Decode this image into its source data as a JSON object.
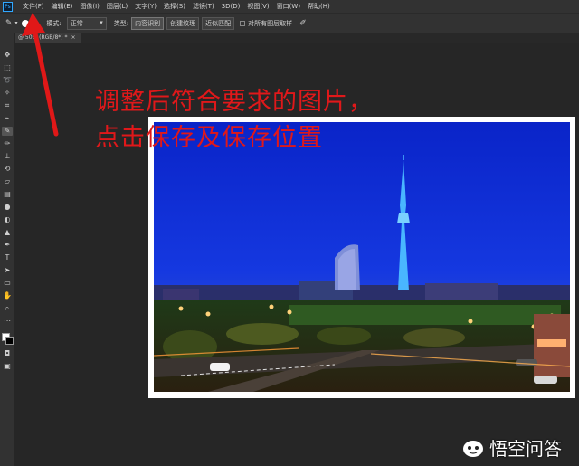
{
  "menubar": {
    "logo": "Ps",
    "items": [
      "文件(F)",
      "编辑(E)",
      "图像(I)",
      "图层(L)",
      "文字(Y)",
      "选择(S)",
      "滤镜(T)",
      "3D(D)",
      "视图(V)",
      "窗口(W)",
      "帮助(H)"
    ]
  },
  "options": {
    "brush_size": "5",
    "mode_label": "模式:",
    "mode_value": "正常",
    "type_label": "类型:",
    "type_buttons": [
      "内容识别",
      "创建纹理",
      "近似匹配"
    ],
    "sample_all_layers": "对所有图层取样"
  },
  "document_tab": {
    "title": "@ 50% (RGB/8*) *"
  },
  "annotation": {
    "line1": "调整后符合要求的图片，",
    "line2": "点击保存及保存位置",
    "color": "#e0181a"
  },
  "watermark": {
    "text": "悟空问答"
  },
  "colors": {
    "ps_accent": "#31a8ff",
    "ui_dark": "#323232",
    "canvas_bg": "#262626"
  }
}
